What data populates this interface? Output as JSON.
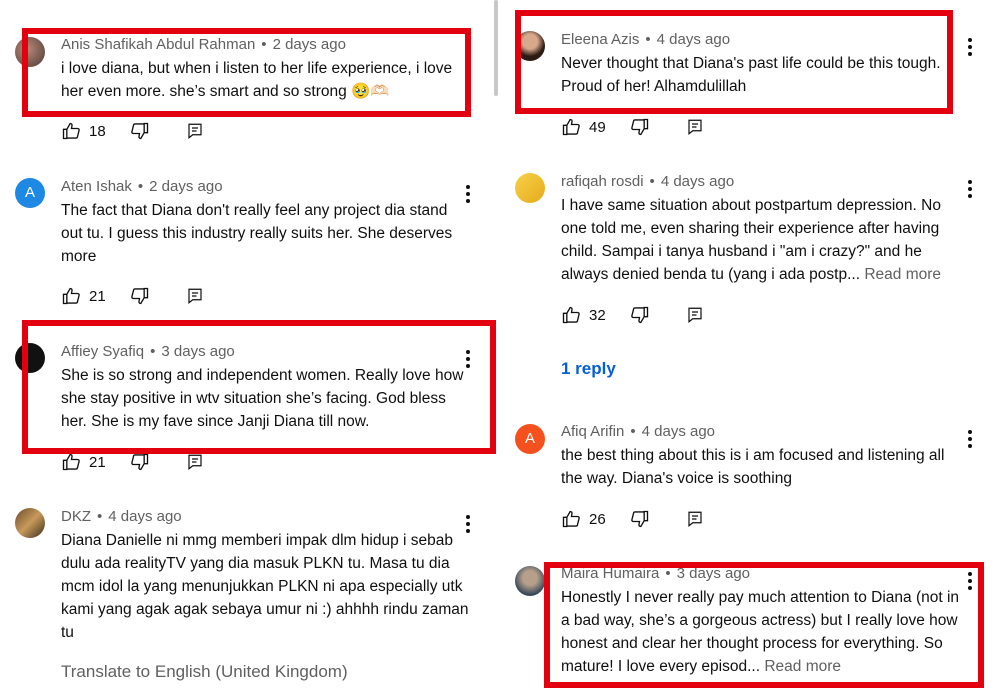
{
  "left": [
    {
      "author": "Anis Shafikah Abdul Rahman",
      "time": "2 days ago",
      "text": "i love diana, but when i listen to her life experience, i love her even more. she’s smart and so strong 🥹🫶🏻",
      "likes": "18",
      "avatar": "photo",
      "highlighted": true
    },
    {
      "author": "Aten Ishak",
      "time": "2 days ago",
      "text": "The fact that Diana don't really feel any project dia stand out tu. I guess this industry really suits her. She deserves more",
      "likes": "21",
      "avatar": "letter",
      "avatar_letter": "A",
      "highlighted": false
    },
    {
      "author": "Affiey Syafiq",
      "time": "3 days ago",
      "text": "She is so strong and independent women. Really love how she stay positive in wtv situation she’s facing. God bless her. She is my fave since Janji Diana till now.",
      "likes": "21",
      "avatar": "photo",
      "highlighted": true
    },
    {
      "author": "DKZ",
      "time": "4 days ago",
      "text": "Diana Danielle ni mmg memberi impak dlm hidup i sebab dulu ada realityTV yang dia masuk PLKN tu. Masa tu dia mcm idol la yang menunjukkan PLKN ni apa especially utk kami yang agak agak sebaya umur ni :) ahhhh rindu zaman tu",
      "avatar": "photo",
      "highlighted": false
    }
  ],
  "translate_label": "Translate to English (United Kingdom)",
  "right": [
    {
      "author": "Eleena Azis",
      "time": "4 days ago",
      "text": "Never thought that Diana's past life could be this tough. Proud of her! Alhamdulillah",
      "likes": "49",
      "avatar": "photo",
      "highlighted": true
    },
    {
      "author": "rafiqah rosdi",
      "time": "4 days ago",
      "text": "I have same situation about postpartum depression. No one told me, even sharing their experience after having child. Sampai i tanya husband i \"am i crazy?\" and he always denied benda tu (yang i ada postp...",
      "read_more": "Read more",
      "likes": "32",
      "avatar": "photo",
      "highlighted": false
    },
    {
      "author": "Afiq Arifin",
      "time": "4 days ago",
      "text": "the best thing about this is i am focused and listening all the way. Diana's voice is soothing",
      "likes": "26",
      "avatar": "letter",
      "avatar_letter": "A",
      "highlighted": false
    },
    {
      "author": "Maira Humaira",
      "time": "3 days ago",
      "text": "Honestly I never really pay much attention to Diana (not in a bad way, she’s a gorgeous actress) but I really love how honest and clear her thought process for everything. So mature! I love every episod...",
      "read_more": "Read more",
      "avatar": "photo",
      "highlighted": true
    }
  ],
  "reply_label": "1 reply",
  "colors": {
    "highlight": "#e3000f",
    "link": "#065fd4",
    "meta": "#606060"
  }
}
